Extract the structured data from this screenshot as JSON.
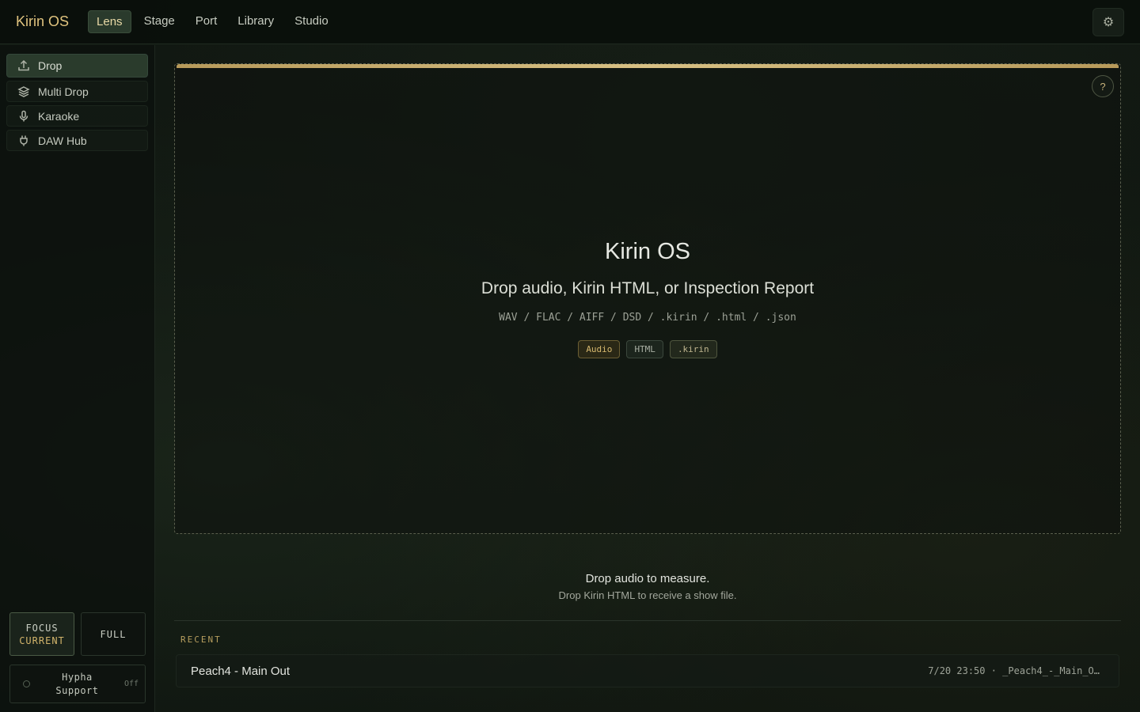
{
  "app": {
    "brand": "Kirin OS"
  },
  "nav": {
    "tabs": [
      {
        "label": "Lens",
        "active": true
      },
      {
        "label": "Stage"
      },
      {
        "label": "Port"
      },
      {
        "label": "Library"
      },
      {
        "label": "Studio"
      }
    ],
    "settings_icon": "gear-icon"
  },
  "sidebar": {
    "items": [
      {
        "label": "Drop",
        "icon": "upload-icon",
        "active": true
      },
      {
        "label": "Multi Drop",
        "icon": "layers-icon"
      },
      {
        "label": "Karaoke",
        "icon": "microphone-icon"
      },
      {
        "label": "DAW Hub",
        "icon": "plug-icon"
      }
    ],
    "modes": {
      "focus_label": "FOCUS",
      "focus_sub": "CURRENT",
      "full_label": "FULL"
    },
    "hypha": {
      "label_line1": "Hypha",
      "label_line2": "Support",
      "state": "Off"
    }
  },
  "dropzone": {
    "title": "Kirin OS",
    "subtitle": "Drop audio, Kirin HTML, or Inspection Report",
    "formats": "WAV / FLAC / AIFF / DSD / .kirin / .html / .json",
    "chips": [
      "Audio",
      "HTML",
      ".kirin"
    ],
    "help": "?"
  },
  "hints": {
    "main": "Drop audio to measure.",
    "sub": "Drop Kirin HTML to receive a show file."
  },
  "recent": {
    "heading": "RECENT",
    "items": [
      {
        "name": "Peach4 - Main Out",
        "meta": "7/20  23:50  ·  _Peach4_-_Main_O…"
      }
    ]
  },
  "colors": {
    "accent_gold": "#d8c184",
    "active_green": "#2a3b2c",
    "background": "#0f1510"
  }
}
